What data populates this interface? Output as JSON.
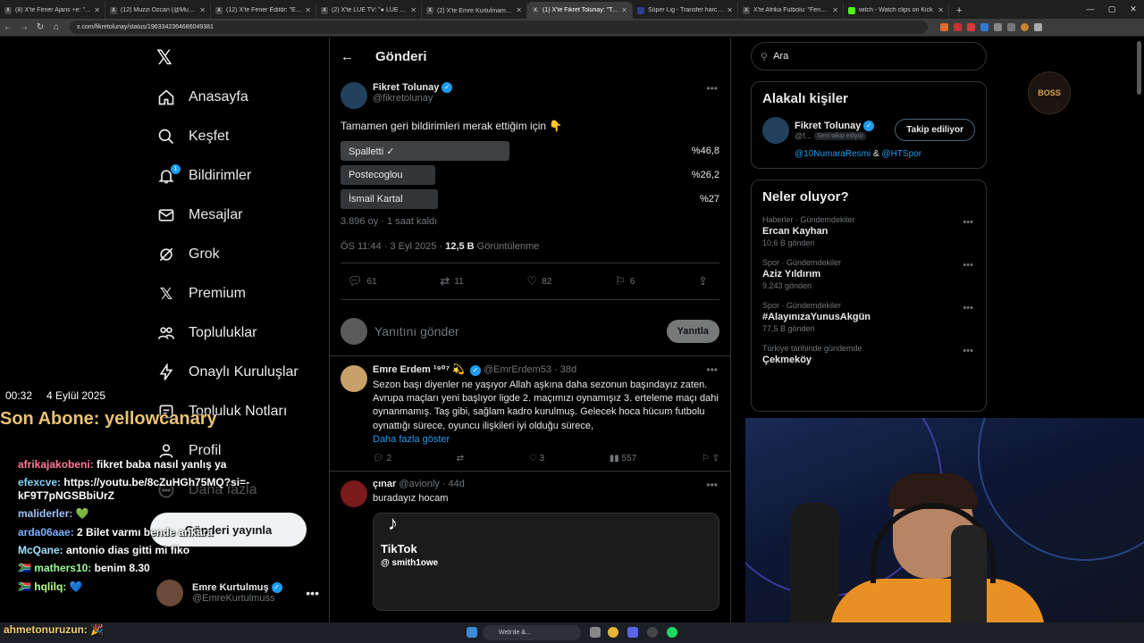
{
  "browser": {
    "tabs": [
      {
        "label": "(8) X'te Fener Ajans +e: \"SON D",
        "active": false
      },
      {
        "label": "(12) Muzzi Ozcan (@Muzzioza",
        "active": false
      },
      {
        "label": "(12) X'te Fener Editör: \"Erdem A",
        "active": false
      },
      {
        "label": "(2) X'te LÜE TV: \"● LÜE TV ÖZ",
        "active": false
      },
      {
        "label": "(2) X'te Emre Kurtulmamış: \"🔺",
        "active": false
      },
      {
        "label": "(1) X'te Fikret Tolunay: \"Taman",
        "active": true
      },
      {
        "label": "Süper Lig - Transfer harcamala",
        "active": false
      },
      {
        "label": "X'te Afrika Futbolu: \"Fenerbah",
        "active": false
      },
      {
        "label": "witch - Watch clips on Kick",
        "active": false
      }
    ],
    "url": "x.com/fikretolunay/status/1963342364686049381"
  },
  "nav": {
    "items": [
      {
        "label": "Anasayfa"
      },
      {
        "label": "Keşfet"
      },
      {
        "label": "Bildirimler",
        "badge": "1"
      },
      {
        "label": "Mesajlar"
      },
      {
        "label": "Grok"
      },
      {
        "label": "Premium"
      },
      {
        "label": "Topluluklar"
      },
      {
        "label": "Onaylı Kuruluşlar"
      },
      {
        "label": "Topluluk Notları"
      },
      {
        "label": "Profil"
      },
      {
        "label": "Daha fazla"
      }
    ],
    "post_button": "Gönderi yayınla",
    "account": {
      "name": "Emre Kurtulmuş",
      "handle": "@EmreKurtulmuss"
    }
  },
  "main": {
    "header_title": "Gönderi",
    "post": {
      "name": "Fikret Tolunay",
      "handle": "@fikretolunay",
      "text": "Tamamen geri bildirimleri merak ettiğim için 👇",
      "poll": [
        {
          "label": "Spalletti ✓",
          "pct": "%46,8",
          "share": 46.8,
          "winner": true
        },
        {
          "label": "Postecoglou",
          "pct": "%26,2",
          "share": 26.2,
          "winner": false
        },
        {
          "label": "İsmail Kartal",
          "pct": "%27",
          "share": 27,
          "winner": false
        }
      ],
      "poll_meta": "3.896 oy · 1 saat kaldı",
      "time": "ÖS 11:44 · 3 Eyl 2025 · ",
      "views": "12,5 B",
      "views_label": " Görüntülenme",
      "stats": {
        "replies": "61",
        "reposts": "11",
        "likes": "82",
        "bookmarks": "6"
      }
    },
    "reply_box": {
      "placeholder": "Yanıtını gönder",
      "button": "Yanıtla"
    },
    "replies": [
      {
        "name": "Emre Erdem ¹⁹⁰⁷ 💫",
        "handle": "@EmrErdem53 · 38d",
        "text": "Sezon başı diyenler ne yaşıyor Allah aşkına daha sezonun başındayız zaten. Avrupa maçları yeni başlıyor ligde 2. maçımızı oynamışız 3. erteleme maçı dahi oynanmamış. Taş gibi, sağlam kadro kurulmuş. Gelecek hoca hücum futbolu oynattığı sürece, oyuncu ilişkileri iyi olduğu sürece,",
        "show_more": "Daha fazla göster",
        "stats": {
          "replies": "2",
          "likes": "3",
          "views": "557"
        }
      },
      {
        "name": "çınar",
        "handle": "@avionly · 44d",
        "text": "buradayız hocam",
        "media": {
          "logo": "TikTok",
          "handle": "@ smith1owe"
        }
      }
    ]
  },
  "right": {
    "search_placeholder": "Ara",
    "related": {
      "title": "Alakalı kişiler",
      "name": "Fikret Tolunay",
      "handle": "@f...",
      "tag": "Seni takip ediyor",
      "follow": "Takip ediliyor",
      "link1": "@10NumaraResmi",
      "amp": " & ",
      "link2": "@HTSpor"
    },
    "trends_title": "Neler oluyor?",
    "trends": [
      {
        "cat": "Haberler · Gündemdekiler",
        "name": "Ercan Kayhan",
        "count": "10,6 B gönderi"
      },
      {
        "cat": "Spor · Gündemdekiler",
        "name": "Aziz Yıldırım",
        "count": "9.243 gönderi"
      },
      {
        "cat": "Spor · Gündemdekiler",
        "name": "#AlayınızaYunusAkgün",
        "count": "77,5 B gönderi"
      },
      {
        "cat": "Türkiye tarihinde gündemde",
        "name": "Çekmeköy",
        "count": ""
      }
    ]
  },
  "overlay": {
    "time": "00:32",
    "date": "4 Eylül 2025",
    "sub_banner": "Son Abone: yellowcanary",
    "boss_logo": "BOSS",
    "chat": [
      {
        "user": "afrikajakobeni:",
        "msg": " fikret baba nasıl yanlış ya",
        "color": "#ff7b9c"
      },
      {
        "user": "efexcve:",
        "msg": " https://youtu.be/8cZuHGh75MQ?si=-kF9T7pNGSBbiUrZ",
        "color": "#7fd7ff"
      },
      {
        "user": "maliderler:",
        "msg": " 💚",
        "color": "#9fc2ff"
      },
      {
        "user": "arda06aae:",
        "msg": " 2 Bilet varmı bende ankara",
        "color": "#7fb0ff"
      },
      {
        "user": "McQane:",
        "msg": " antonio dias gitti mi fiko",
        "color": "#9fe0ff"
      },
      {
        "user": "🇿🇦 mathers10:",
        "msg": " benim 8.30",
        "color": "#9cff9c"
      },
      {
        "user": "🇿🇦 hqlilq:",
        "msg": " 💙",
        "color": "#b6ff8a"
      }
    ],
    "bottom_chat": "ahmetonuruzun: 🎉"
  },
  "taskbar": {
    "search": "Web'de &..."
  }
}
